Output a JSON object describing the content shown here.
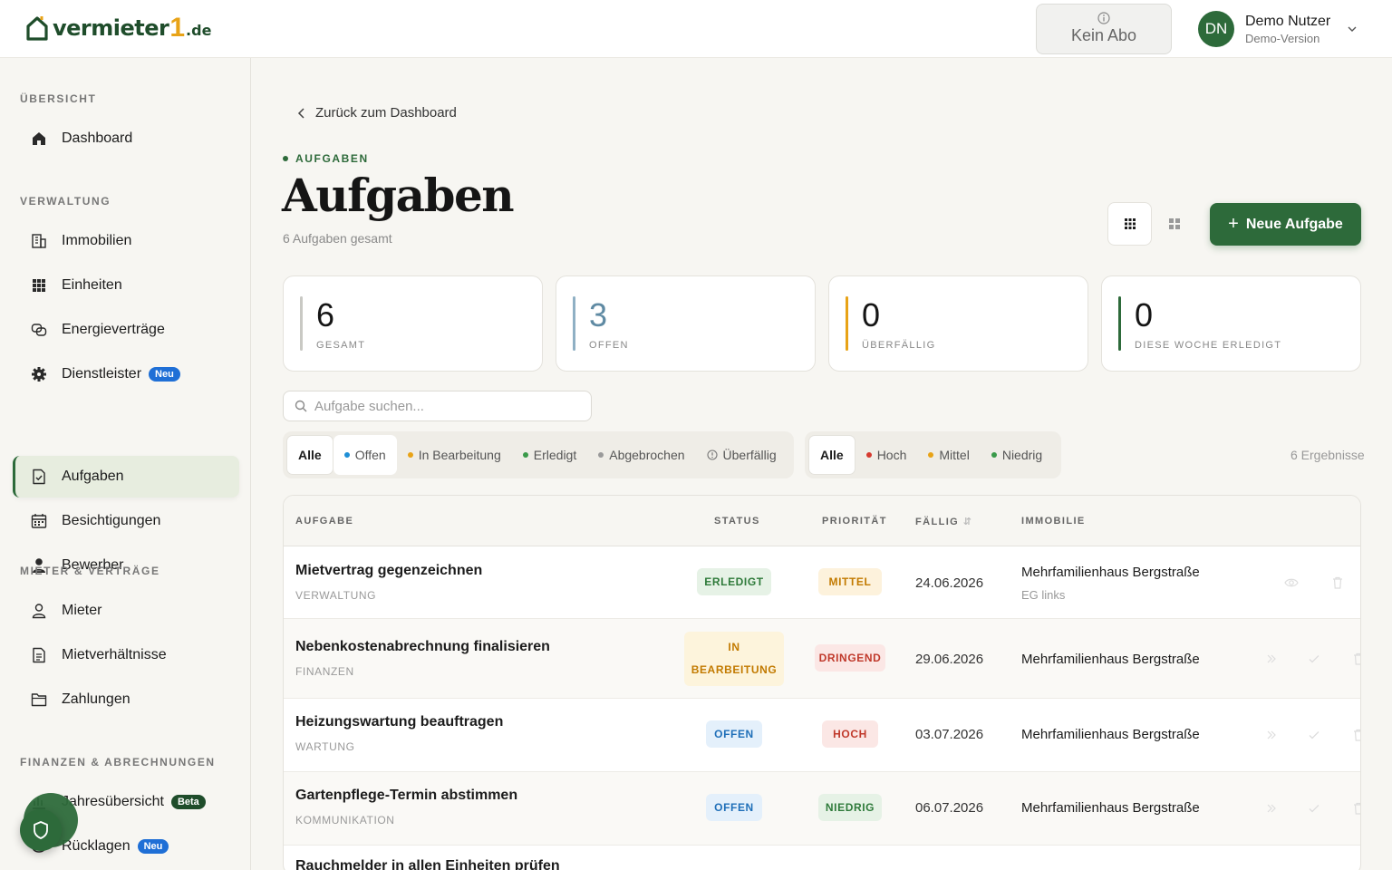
{
  "header": {
    "logo_text": "vermieter",
    "logo_one": "1",
    "logo_domain": ".de",
    "subscription_label": "Kein Abo",
    "user_initials": "DN",
    "user_name": "Demo Nutzer",
    "user_subtitle": "Demo-Version"
  },
  "sidebar": {
    "sections": [
      {
        "title": "ÜBERSICHT"
      },
      {
        "title": "VERWALTUNG"
      },
      {
        "title": "MIETER & VERTRÄGE"
      },
      {
        "title": "FINANZEN & ABRECHNUNGEN"
      }
    ],
    "items": [
      {
        "label": "Dashboard",
        "icon": "home-icon"
      },
      {
        "label": "Immobilien",
        "icon": "building-icon"
      },
      {
        "label": "Einheiten",
        "icon": "grid-icon"
      },
      {
        "label": "Energieverträge",
        "icon": "energy-contract-icon"
      },
      {
        "label": "Dienstleister",
        "icon": "gear-icon",
        "badge": "Neu"
      },
      {
        "label": "Aufgaben",
        "icon": "task-icon",
        "active": true
      },
      {
        "label": "Besichtigungen",
        "icon": "calendar-icon"
      },
      {
        "label": "Bewerber",
        "icon": "person-filled-icon"
      },
      {
        "label": "Mieter",
        "icon": "person-icon"
      },
      {
        "label": "Mietverhältnisse",
        "icon": "document-icon"
      },
      {
        "label": "Zahlungen",
        "icon": "folder-icon"
      },
      {
        "label": "Jahresübersicht",
        "icon": "chart-icon",
        "badge": "Beta"
      },
      {
        "label": "Rücklagen",
        "icon": "piggy-bank-icon",
        "badge": "Neu"
      }
    ]
  },
  "main": {
    "back_label": "Zurück zum Dashboard",
    "eyebrow": "AUFGABEN",
    "title": "Aufgaben",
    "subtitle": "6 Aufgaben gesamt",
    "new_button": "Neue Aufgabe",
    "stats": [
      {
        "value": "6",
        "label": "GESAMT",
        "color": "#c9c9c4"
      },
      {
        "value": "3",
        "label": "OFFEN",
        "color": "#8fb0c4"
      },
      {
        "value": "0",
        "label": "ÜBERFÄLLIG",
        "color": "#e8a317"
      },
      {
        "value": "0",
        "label": "DIESE WOCHE ERLEDIGT",
        "color": "#2d6a3a"
      }
    ],
    "search_placeholder": "Aufgabe suchen...",
    "status_filters": [
      {
        "label": "Alle",
        "active": true
      },
      {
        "label": "Offen",
        "dot": "#1f8fd6"
      },
      {
        "label": "In Bearbeitung",
        "dot": "#e8a317"
      },
      {
        "label": "Erledigt",
        "dot": "#3a9a4a"
      },
      {
        "label": "Abgebrochen",
        "dot": "#9a9a9a"
      },
      {
        "label": "Überfällig",
        "icon": "alert-circle-icon"
      }
    ],
    "priority_filters": [
      {
        "label": "Alle",
        "active": true
      },
      {
        "label": "Hoch",
        "dot": "#d63a2f"
      },
      {
        "label": "Mittel",
        "dot": "#e8a317"
      },
      {
        "label": "Niedrig",
        "dot": "#3a9a4a"
      }
    ],
    "results": "6 Ergebnisse",
    "table": {
      "columns": [
        "AUFGABE",
        "STATUS",
        "PRIORITÄT",
        "FÄLLIG",
        "IMMOBILIE"
      ],
      "rows": [
        {
          "title": "Mietvertrag gegenzeichnen",
          "category": "VERWALTUNG",
          "status": "ERLEDIGT",
          "priority": "MITTEL",
          "due": "24.06.2026",
          "property": "Mehrfamilienhaus Bergstraße",
          "unit": "EG links"
        },
        {
          "title": "Nebenkostenabrechnung finalisieren",
          "category": "FINANZEN",
          "status_line1": "IN",
          "status_line2": "BEARBEITUNG",
          "priority": "DRINGEND",
          "due": "29.06.2026",
          "property": "Mehrfamilienhaus Bergstraße"
        },
        {
          "title": "Heizungswartung beauftragen",
          "category": "WARTUNG",
          "status": "OFFEN",
          "priority": "HOCH",
          "due": "03.07.2026",
          "property": "Mehrfamilienhaus Bergstraße"
        },
        {
          "title": "Gartenpflege-Termin abstimmen",
          "category": "KOMMUNIKATION",
          "status": "OFFEN",
          "priority": "NIEDRIG",
          "due": "06.07.2026",
          "property": "Mehrfamilienhaus Bergstraße"
        },
        {
          "title": "Rauchmelder in allen Einheiten prüfen"
        }
      ]
    }
  }
}
